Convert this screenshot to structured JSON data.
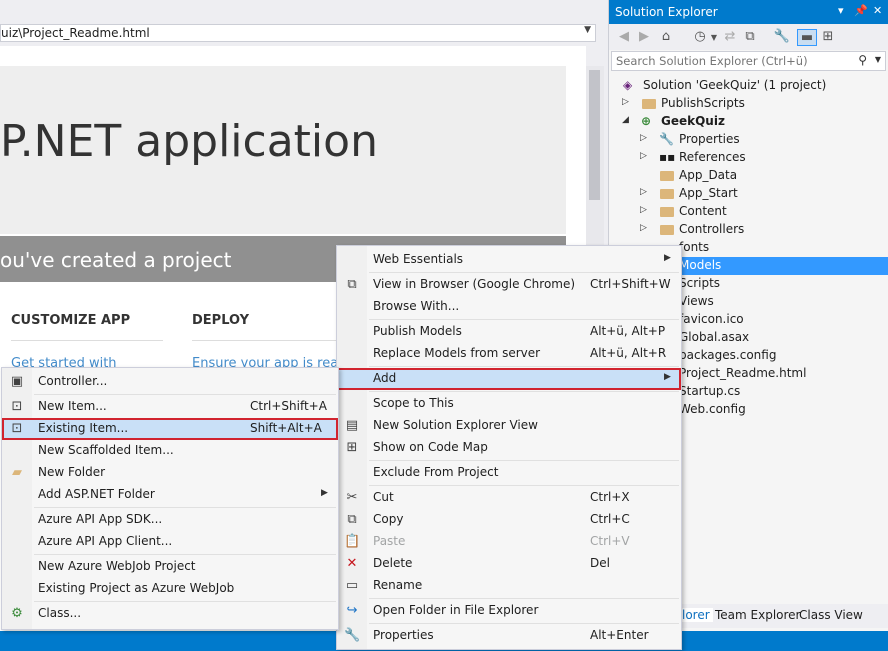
{
  "browser": {
    "address": "uiz\\Project_Readme.html",
    "jumbotron_title": "P.NET application",
    "banner_text": "ou've created a project",
    "col1_heading": "CUSTOMIZE APP",
    "col1_link": "Get started with",
    "col2_heading": "DEPLOY",
    "col2_link": "Ensure your app is read"
  },
  "solution_explorer": {
    "title": "Solution Explorer",
    "search_placeholder": "Search Solution Explorer (Ctrl+ü)",
    "tree": [
      {
        "label": "Solution 'GeekQuiz' (1 project)"
      },
      {
        "label": "PublishScripts"
      },
      {
        "label": "GeekQuiz"
      },
      {
        "label": "Properties"
      },
      {
        "label": "References"
      },
      {
        "label": "App_Data"
      },
      {
        "label": "App_Start"
      },
      {
        "label": "Content"
      },
      {
        "label": "Controllers"
      },
      {
        "label": "fonts"
      },
      {
        "label": "Models"
      },
      {
        "label": "Scripts"
      },
      {
        "label": "Views"
      },
      {
        "label": "favicon.ico"
      },
      {
        "label": "Global.asax"
      },
      {
        "label": "packages.config"
      },
      {
        "label": "Project_Readme.html"
      },
      {
        "label": "Startup.cs"
      },
      {
        "label": "Web.config"
      }
    ],
    "tabs": [
      "lorer",
      "Team Explorer",
      "Class View"
    ]
  },
  "context_menu": {
    "items": [
      {
        "label": "Web Essentials",
        "shortcut": ""
      },
      {
        "label": "View in Browser (Google Chrome)",
        "shortcut": "Ctrl+Shift+W"
      },
      {
        "label": "Browse With...",
        "shortcut": ""
      },
      {
        "label": "Publish Models",
        "shortcut": "Alt+ü, Alt+P"
      },
      {
        "label": "Replace Models from server",
        "shortcut": "Alt+ü, Alt+R"
      },
      {
        "label": "Add",
        "shortcut": ""
      },
      {
        "label": "Scope to This",
        "shortcut": ""
      },
      {
        "label": "New Solution Explorer View",
        "shortcut": ""
      },
      {
        "label": "Show on Code Map",
        "shortcut": ""
      },
      {
        "label": "Exclude From Project",
        "shortcut": ""
      },
      {
        "label": "Cut",
        "shortcut": "Ctrl+X"
      },
      {
        "label": "Copy",
        "shortcut": "Ctrl+C"
      },
      {
        "label": "Paste",
        "shortcut": "Ctrl+V"
      },
      {
        "label": "Delete",
        "shortcut": "Del"
      },
      {
        "label": "Rename",
        "shortcut": ""
      },
      {
        "label": "Open Folder in File Explorer",
        "shortcut": ""
      },
      {
        "label": "Properties",
        "shortcut": "Alt+Enter"
      }
    ]
  },
  "add_submenu": {
    "items": [
      {
        "label": "Controller...",
        "shortcut": ""
      },
      {
        "label": "New Item...",
        "shortcut": "Ctrl+Shift+A"
      },
      {
        "label": "Existing Item...",
        "shortcut": "Shift+Alt+A"
      },
      {
        "label": "New Scaffolded Item...",
        "shortcut": ""
      },
      {
        "label": "New Folder",
        "shortcut": ""
      },
      {
        "label": "Add ASP.NET Folder",
        "shortcut": ""
      },
      {
        "label": "Azure API App SDK...",
        "shortcut": ""
      },
      {
        "label": "Azure API App Client...",
        "shortcut": ""
      },
      {
        "label": "New Azure WebJob Project",
        "shortcut": ""
      },
      {
        "label": "Existing Project as Azure WebJob",
        "shortcut": ""
      },
      {
        "label": "Class...",
        "shortcut": ""
      }
    ]
  },
  "colors": {
    "accent": "#007acc",
    "selection": "#3399ff",
    "highlight_border": "#d1242f"
  }
}
